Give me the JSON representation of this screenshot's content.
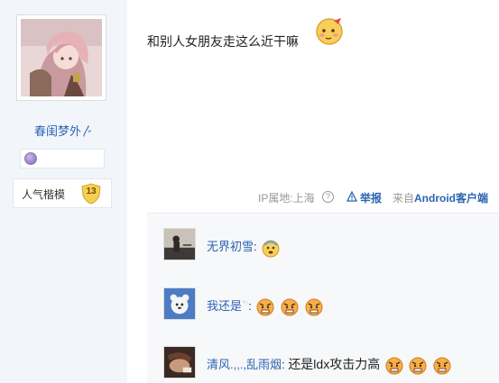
{
  "author": {
    "name": "春闺梦外〴",
    "level_badge_icon": "level-badge-icon",
    "popularity_label": "人气楷模",
    "popularity_value": "13"
  },
  "post": {
    "text": "和别人女朋友走这么近干嘛",
    "emoticon": "blush-face-icon",
    "meta": {
      "ip": "IP属地:上海",
      "report": "举报",
      "source_prefix": "来自",
      "source_link": "Android客户端"
    }
  },
  "replies": [
    {
      "name": "无界初雪",
      "colon": ":",
      "text": "",
      "emoticons": [
        "sweat-face-icon"
      ]
    },
    {
      "name": "我还是",
      "suffix": "☜",
      "colon": ":",
      "text": "",
      "emoticons": [
        "angry-face-icon",
        "angry-face-icon",
        "angry-face-icon"
      ]
    },
    {
      "name": "清风.,,.,乱雨烟",
      "colon": ":",
      "text": "还是ldx攻击力高",
      "emoticons": [
        "angry-face-icon",
        "angry-face-icon",
        "angry-face-icon"
      ]
    }
  ],
  "colors": {
    "link": "#2d64b3",
    "sidebar_bg": "#f2f6fb",
    "reply_bg": "#f7f8fa"
  }
}
